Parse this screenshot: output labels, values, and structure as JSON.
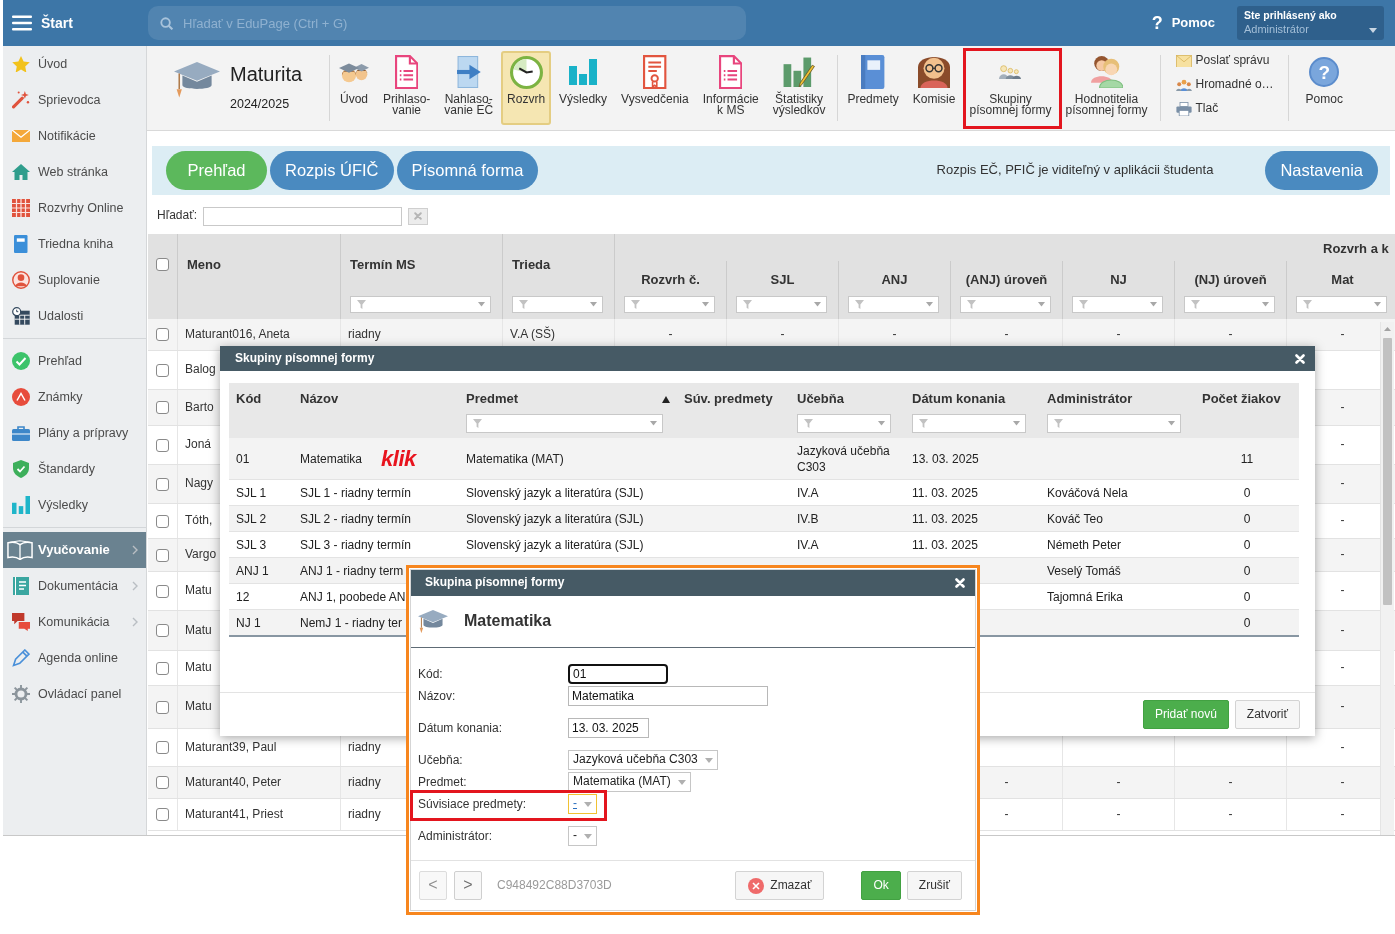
{
  "topbar": {
    "menu_label": "Štart",
    "search": {
      "placeholder": "Hľadať v EduPage (Ctrl + G)"
    },
    "help": {
      "glyph": "?",
      "label": "Pomoc"
    },
    "user": {
      "caption": "Ste prihlásený ako",
      "role": "Administrátor"
    }
  },
  "sidebar": {
    "groups": [
      [
        {
          "label": "Úvod",
          "selected": false,
          "submenu": false
        },
        {
          "label": "Sprievodca",
          "selected": false,
          "submenu": false
        },
        {
          "label": "Notifikácie",
          "selected": false,
          "submenu": false
        },
        {
          "label": "Web stránka",
          "selected": false,
          "submenu": false
        },
        {
          "label": "Rozvrhy Online",
          "selected": false,
          "submenu": false
        },
        {
          "label": "Triedna kniha",
          "selected": false,
          "submenu": false
        },
        {
          "label": "Suplovanie",
          "selected": false,
          "submenu": false
        },
        {
          "label": "Udalosti",
          "selected": false,
          "submenu": false
        }
      ],
      [
        {
          "label": "Prehľad",
          "selected": false,
          "submenu": false
        },
        {
          "label": "Známky",
          "selected": false,
          "submenu": false
        },
        {
          "label": "Plány a prípravy",
          "selected": false,
          "submenu": false
        },
        {
          "label": "Štandardy",
          "selected": false,
          "submenu": false
        },
        {
          "label": "Výsledky",
          "selected": false,
          "submenu": false
        }
      ],
      [
        {
          "label": "Vyučovanie",
          "selected": true,
          "submenu": true
        },
        {
          "label": "Dokumentácia",
          "selected": false,
          "submenu": true
        },
        {
          "label": "Komunikácia",
          "selected": false,
          "submenu": true
        },
        {
          "label": "Agenda online",
          "selected": false,
          "submenu": false
        },
        {
          "label": "Ovládací panel",
          "selected": false,
          "submenu": false
        }
      ]
    ]
  },
  "toolbar": {
    "module": {
      "title": "Maturita",
      "year": "2024/2025"
    },
    "groups": [
      [
        {
          "lines": [
            "Úvod"
          ],
          "selected": false,
          "highlighted": false
        },
        {
          "lines": [
            "Prihlaso-",
            "vanie"
          ],
          "selected": false,
          "highlighted": false
        },
        {
          "lines": [
            "Nahlaso-",
            "vanie EČ"
          ],
          "selected": false,
          "highlighted": false
        },
        {
          "lines": [
            "Rozvrh"
          ],
          "selected": true,
          "highlighted": false
        },
        {
          "lines": [
            "Výsledky"
          ],
          "selected": false,
          "highlighted": false
        },
        {
          "lines": [
            "Vysvedčenia"
          ],
          "selected": false,
          "highlighted": false
        },
        {
          "lines": [
            "Informácie",
            "k MS"
          ],
          "selected": false,
          "highlighted": false
        },
        {
          "lines": [
            "Štatistiky",
            "výsledkov"
          ],
          "selected": false,
          "highlighted": false
        }
      ],
      [
        {
          "lines": [
            "Predmety"
          ],
          "selected": false,
          "highlighted": false
        },
        {
          "lines": [
            "Komisie"
          ],
          "selected": false,
          "highlighted": false
        },
        {
          "lines": [
            "Skupiny",
            "písomnej formy"
          ],
          "selected": false,
          "highlighted": true
        },
        {
          "lines": [
            "Hodnotitelia",
            "písomnej formy"
          ],
          "selected": false,
          "highlighted": false
        }
      ]
    ],
    "quick_actions": [
      "Poslať správu",
      "Hromadné o…",
      "Tlač"
    ],
    "help": {
      "glyph": "?",
      "label": "Pomoc"
    }
  },
  "tabs": [
    {
      "label": "Prehľad",
      "selected": true
    },
    {
      "label": "Rozpis ÚFIČ",
      "selected": false
    },
    {
      "label": "Písomná forma",
      "selected": false
    }
  ],
  "tab_bar": {
    "notice": "Rozpis EČ, PFIČ je viditeľný v aplikácii študenta",
    "settings": "Nastavenia"
  },
  "search": {
    "label": "Hľadať:"
  },
  "students": {
    "select_all": false,
    "columns": [
      {
        "label": "Meno",
        "filter": false
      },
      {
        "label": "Termín MS",
        "filter": true
      },
      {
        "label": "Trieda",
        "filter": true
      }
    ],
    "group": {
      "label": "Rozvrh a k",
      "columns": [
        {
          "label": "Rozvrh č.",
          "filter": true
        },
        {
          "label": "SJL",
          "filter": true
        },
        {
          "label": "ANJ",
          "filter": true
        },
        {
          "label": "(ANJ) úroveň",
          "filter": true
        },
        {
          "label": "NJ",
          "filter": true
        },
        {
          "label": "(NJ) úroveň",
          "filter": true
        },
        {
          "label": "Mat",
          "filter": true
        }
      ]
    },
    "rows": [
      {
        "checked": false,
        "cells": [
          "Maturant016, Aneta",
          "riadny",
          "V.A (SŠ)",
          "-",
          "-",
          "-",
          "-",
          "-",
          "-",
          "-"
        ]
      },
      {
        "checked": false,
        "cells": [
          "Balog",
          null,
          null,
          null,
          null,
          null,
          null,
          null,
          null,
          null
        ]
      },
      {
        "checked": false,
        "cells": [
          "Barto",
          null,
          null,
          null,
          null,
          null,
          null,
          null,
          null,
          "-"
        ]
      },
      {
        "checked": false,
        "cells": [
          "Joná",
          null,
          null,
          null,
          null,
          null,
          null,
          null,
          null,
          "-"
        ]
      },
      {
        "checked": false,
        "cells": [
          "Nagy",
          null,
          null,
          null,
          null,
          null,
          null,
          null,
          null,
          "-"
        ]
      },
      {
        "checked": false,
        "cells": [
          "Tóth,",
          null,
          null,
          null,
          null,
          null,
          null,
          null,
          null,
          "-"
        ]
      },
      {
        "checked": false,
        "cells": [
          "Vargo",
          null,
          null,
          null,
          null,
          null,
          null,
          null,
          null,
          "-"
        ]
      },
      {
        "checked": false,
        "cells": [
          "Matu",
          null,
          null,
          null,
          null,
          null,
          null,
          null,
          null,
          "-"
        ]
      },
      {
        "checked": false,
        "cells": [
          "Matu",
          null,
          null,
          null,
          null,
          null,
          null,
          null,
          null,
          "-"
        ]
      },
      {
        "checked": false,
        "cells": [
          "Matu",
          null,
          null,
          null,
          null,
          null,
          null,
          null,
          null,
          "-"
        ]
      },
      {
        "checked": false,
        "cells": [
          "Matu",
          null,
          null,
          null,
          null,
          null,
          null,
          null,
          null,
          "-"
        ]
      },
      {
        "checked": false,
        "cells": [
          "Maturant39, Paul",
          "riadny",
          null,
          null,
          null,
          null,
          null,
          null,
          null,
          "-"
        ]
      },
      {
        "checked": false,
        "cells": [
          "Maturant40, Peter",
          "riadny",
          null,
          null,
          null,
          null,
          "-",
          "-",
          "-",
          "-"
        ]
      },
      {
        "checked": false,
        "cells": [
          "Maturant41, Priest",
          "riadny",
          null,
          null,
          null,
          null,
          "-",
          "-",
          "-",
          "-"
        ]
      }
    ]
  },
  "groups_dialog": {
    "title": "Skupiny písomnej formy",
    "columns": [
      {
        "label": "Kód",
        "filter": false,
        "sorted": false
      },
      {
        "label": "Názov",
        "filter": false,
        "sorted": false
      },
      {
        "label": "Predmet",
        "filter": true,
        "sorted": true
      },
      {
        "label": "Súv. predmety",
        "filter": false,
        "sorted": false
      },
      {
        "label": "Učebňa",
        "filter": true,
        "sorted": false
      },
      {
        "label": "Dátum konania",
        "filter": true,
        "sorted": false
      },
      {
        "label": "Administrátor",
        "filter": true,
        "sorted": false
      },
      {
        "label": "Počet žiakov",
        "filter": false,
        "sorted": false
      }
    ],
    "rows": [
      {
        "note": "klik",
        "cells": [
          "01",
          "Matematika",
          "Matematika (MAT)",
          null,
          "Jazyková učebňa C303",
          "13. 03. 2025",
          null,
          "11"
        ]
      },
      {
        "cells": [
          "SJL 1",
          "SJL 1 - riadny termín",
          "Slovenský jazyk a literatúra (SJL)",
          null,
          "IV.A",
          "11. 03. 2025",
          "Kováčová Nela",
          "0"
        ]
      },
      {
        "cells": [
          "SJL 2",
          "SJL 2 - riadny termín",
          "Slovenský jazyk a literatúra (SJL)",
          null,
          "IV.B",
          "11. 03. 2025",
          "Kováč Teo",
          "0"
        ]
      },
      {
        "cells": [
          "SJL 3",
          "SJL 3 - riadny termín",
          "Slovenský jazyk a literatúra (SJL)",
          null,
          "IV.A",
          "11. 03. 2025",
          "Németh Peter",
          "0"
        ]
      },
      {
        "cells": [
          "ANJ 1",
          "ANJ 1 - riadny term",
          null,
          null,
          null,
          null,
          "Veselý Tomáš",
          "0"
        ]
      },
      {
        "cells": [
          "12",
          "ANJ 1, poobede AN",
          null,
          null,
          null,
          null,
          "Tajomná Erika",
          "0"
        ]
      },
      {
        "cells": [
          "NJ 1",
          "NemJ 1 - riadny ter",
          null,
          null,
          null,
          null,
          null,
          "0"
        ]
      }
    ],
    "buttons": [
      {
        "label": "Pridať novú",
        "kind": "primary"
      },
      {
        "label": "Zatvoriť",
        "kind": "default"
      }
    ]
  },
  "group_dialog": {
    "title": "Skupina písomnej formy",
    "heading": "Matematika",
    "highlighted": true,
    "field_groups": [
      [
        {
          "label": "Kód:",
          "kind": "input",
          "value": "01",
          "focused": true,
          "hovered": false,
          "highlighted": false
        },
        {
          "label": "Názov:",
          "kind": "input",
          "value": "Matematika",
          "focused": false,
          "hovered": false,
          "highlighted": false
        }
      ],
      [
        {
          "label": "Dátum konania:",
          "kind": "input",
          "value": "13. 03. 2025",
          "focused": false,
          "hovered": false,
          "highlighted": false
        }
      ],
      [
        {
          "label": "Učebňa:",
          "kind": "select",
          "value": "Jazyková učebňa C303",
          "focused": false,
          "hovered": false,
          "highlighted": false
        },
        {
          "label": "Predmet:",
          "kind": "select",
          "value": "Matematika (MAT)",
          "focused": false,
          "hovered": false,
          "highlighted": false
        },
        {
          "label": "Súvisiace predmety:",
          "kind": "select",
          "value": "-",
          "focused": false,
          "hovered": true,
          "highlighted": true
        }
      ],
      [
        {
          "label": "Administrátor:",
          "kind": "select",
          "value": "-",
          "focused": false,
          "hovered": false,
          "highlighted": false
        }
      ]
    ],
    "nav": [
      {
        "label": "<",
        "disabled": true
      },
      {
        "label": ">",
        "disabled": false
      }
    ],
    "record_id": "C948492C88D3703D",
    "buttons": [
      {
        "label": "Zmazať",
        "kind": "delete"
      },
      {
        "label": "Ok",
        "kind": "confirm"
      },
      {
        "label": "Zrušiť",
        "kind": "cancel"
      }
    ]
  }
}
